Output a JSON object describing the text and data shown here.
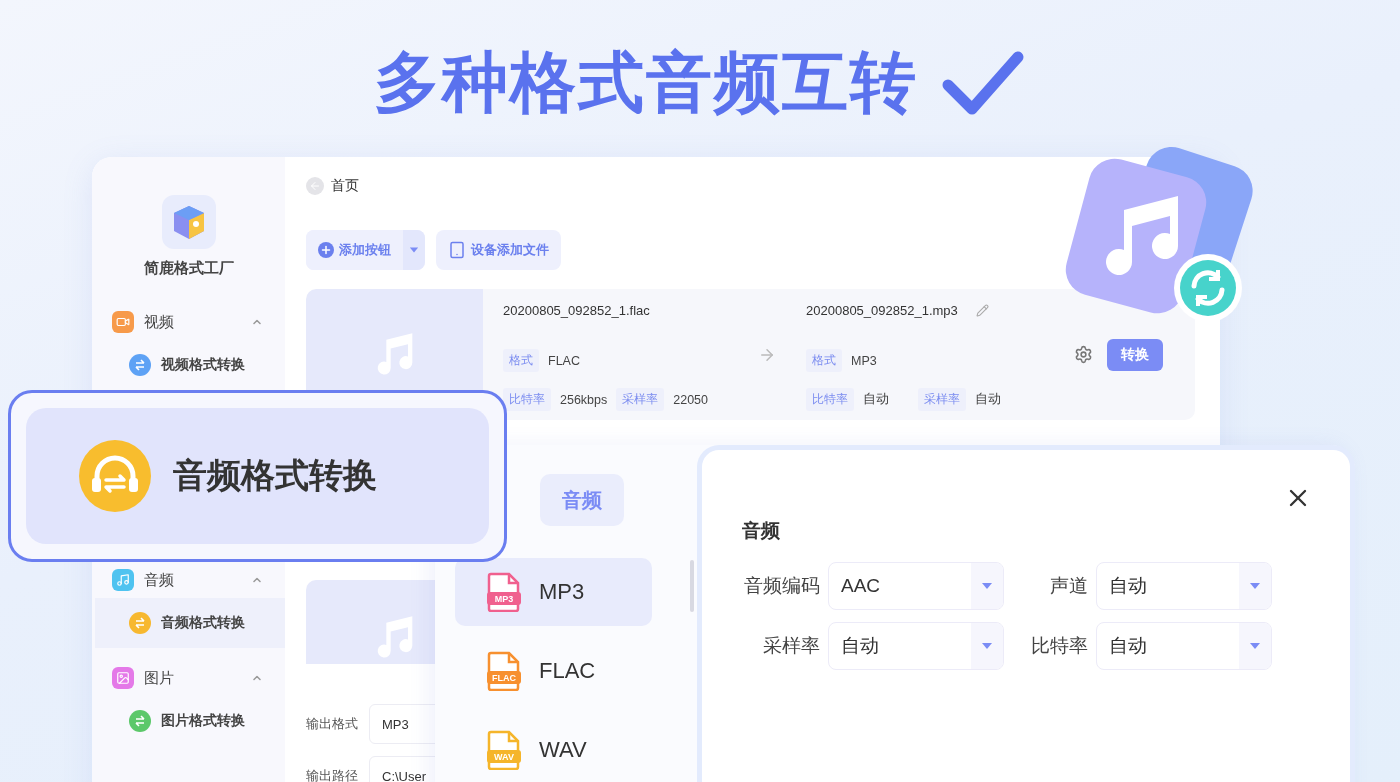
{
  "headline": {
    "title": "多种格式音频互转"
  },
  "app": {
    "breadcrumb": "首页",
    "brand": "简鹿格式工厂",
    "sidebar": [
      {
        "label": "视频",
        "kind": "video",
        "expanded": true,
        "children": [
          {
            "label": "视频格式转换",
            "selected": false
          }
        ]
      },
      {
        "label": "音频",
        "kind": "audio",
        "expanded": true,
        "children": [
          {
            "label": "音频格式转换",
            "selected": true
          }
        ]
      },
      {
        "label": "图片",
        "kind": "image",
        "expanded": true,
        "children": [
          {
            "label": "图片格式转换",
            "selected": false
          }
        ]
      }
    ],
    "toolbar": {
      "add_button": "添加按钮",
      "device_button": "设备添加文件"
    },
    "file": {
      "source_name": "20200805_092852_1.flac",
      "target_name": "20200805_092852_1.mp3",
      "source": [
        {
          "label": "格式",
          "value": "FLAC"
        },
        {
          "label": "比特率",
          "value": "256kbps"
        },
        {
          "label": "采样率",
          "value": "22050"
        }
      ],
      "target": [
        {
          "label": "格式",
          "value": "MP3"
        },
        {
          "label": "比特率",
          "value": "自动"
        },
        {
          "label": "采样率",
          "value": "自动"
        }
      ],
      "convert_button": "转换"
    },
    "output": [
      {
        "label": "输出格式",
        "value": "MP3"
      },
      {
        "label": "输出路径",
        "value": "C:\\User"
      }
    ]
  },
  "callout": {
    "label": "音频格式转换"
  },
  "popup": {
    "tab": "音频",
    "formats": [
      {
        "label": "MP3",
        "badge": "MP3",
        "color": "#f0608e",
        "selected": true
      },
      {
        "label": "FLAC",
        "badge": "FLAC",
        "color": "#f7902f",
        "selected": false
      },
      {
        "label": "WAV",
        "badge": "WAV",
        "color": "#f5b52a",
        "selected": false
      }
    ],
    "section_title": "音频",
    "settings": [
      {
        "label": "音频编码",
        "value": "AAC"
      },
      {
        "label": "声道",
        "value": "自动"
      },
      {
        "label": "采样率",
        "value": "自动"
      },
      {
        "label": "比特率",
        "value": "自动"
      }
    ]
  }
}
